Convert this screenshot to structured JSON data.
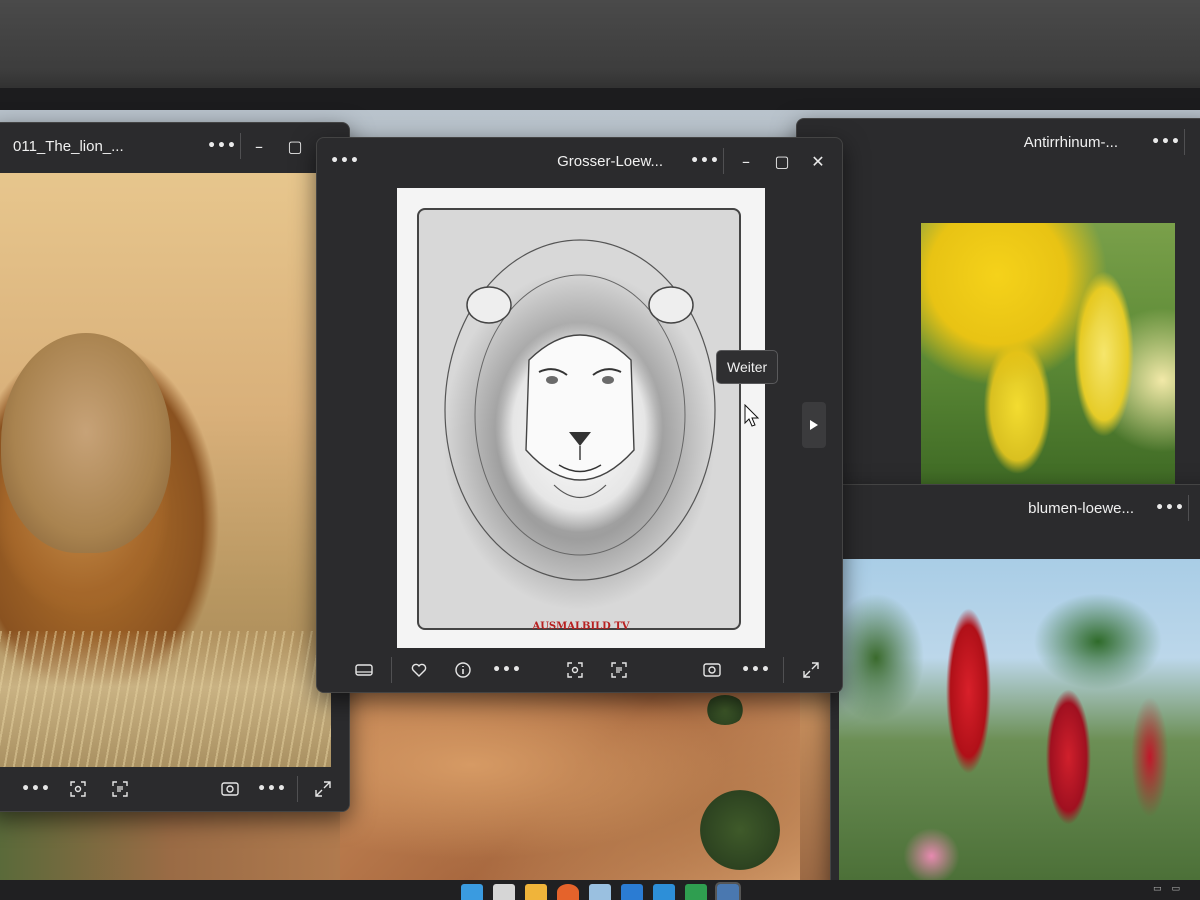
{
  "windows": {
    "lion_photo": {
      "title": "011_The_lion_..."
    },
    "coloring_page": {
      "title": "Grosser-Loew...",
      "brand_text": "AUSMALBILD TV",
      "tooltip": "Weiter"
    },
    "antirrhinum": {
      "title": "Antirrhinum-..."
    },
    "blumen": {
      "title": "blumen-loewe..."
    }
  },
  "icons": {
    "more": "more-icon",
    "minimize": "minimize-icon",
    "maximize": "maximize-icon",
    "close": "close-icon",
    "filmstrip": "filmstrip-icon",
    "favorite": "heart-icon",
    "info": "info-icon",
    "visual_search": "visual-search-icon",
    "text_scan": "text-scan-icon",
    "edit": "edit-image-icon",
    "fullscreen": "fullscreen-icon",
    "next": "play-next-icon"
  },
  "colors": {
    "window_bg": "#2b2b2d",
    "title_text": "#f0f0f0",
    "brand_red": "#b82020"
  },
  "taskbar": {
    "apps": [
      "windows-start",
      "task-view",
      "file-explorer",
      "firefox",
      "notepad",
      "word-app",
      "photos-app",
      "spreadsheet-app",
      "photos-active"
    ]
  }
}
